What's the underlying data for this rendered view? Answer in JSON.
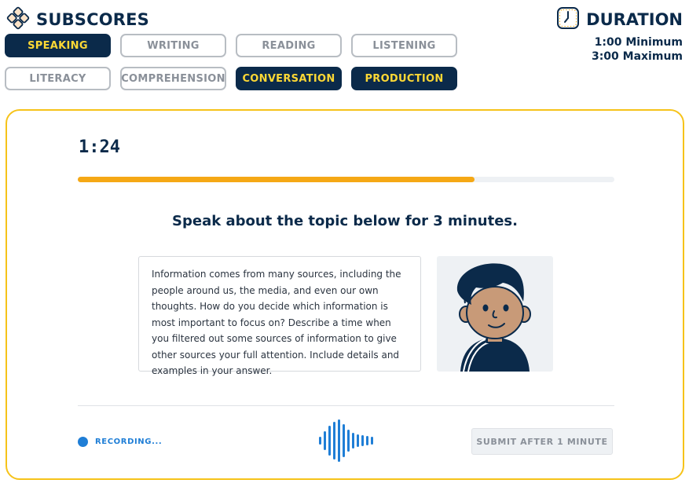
{
  "header": {
    "subscores_title": "SUBSCORES",
    "subscores_icon": "diamond-grid-icon",
    "subscores": [
      {
        "label": "SPEAKING",
        "active": true
      },
      {
        "label": "WRITING",
        "active": false
      },
      {
        "label": "READING",
        "active": false
      },
      {
        "label": "LISTENING",
        "active": false
      },
      {
        "label": "LITERACY",
        "active": false
      },
      {
        "label": "COMPREHENSION",
        "active": false
      },
      {
        "label": "CONVERSATION",
        "active": true
      },
      {
        "label": "PRODUCTION",
        "active": true
      }
    ],
    "duration_title": "DURATION",
    "duration_icon": "clock-icon",
    "duration_min": "1:00 Minimum",
    "duration_max": "3:00 Maximum"
  },
  "task": {
    "timer": "1:24",
    "progress": 0.74,
    "instruction": "Speak about the topic below for 3 minutes.",
    "prompt": "Information comes from many sources, including the people around us, the media, and even our own thoughts. How do you decide which information is most important to focus on? Describe a time when you filtered out some sources of information to give other sources your full attention. Include details and examples in your answer.",
    "recording_label": "RECORDING...",
    "waveform_icon": "audio-waveform-icon",
    "submit_label": "SUBMIT AFTER 1 MINUTE"
  },
  "colors": {
    "navy": "#0b2a4a",
    "yellow": "#fdd835",
    "card_border": "#f6c31a",
    "progress": "#f5a815",
    "recording_blue": "#1f7ed6",
    "muted_gray": "#8a9099"
  }
}
